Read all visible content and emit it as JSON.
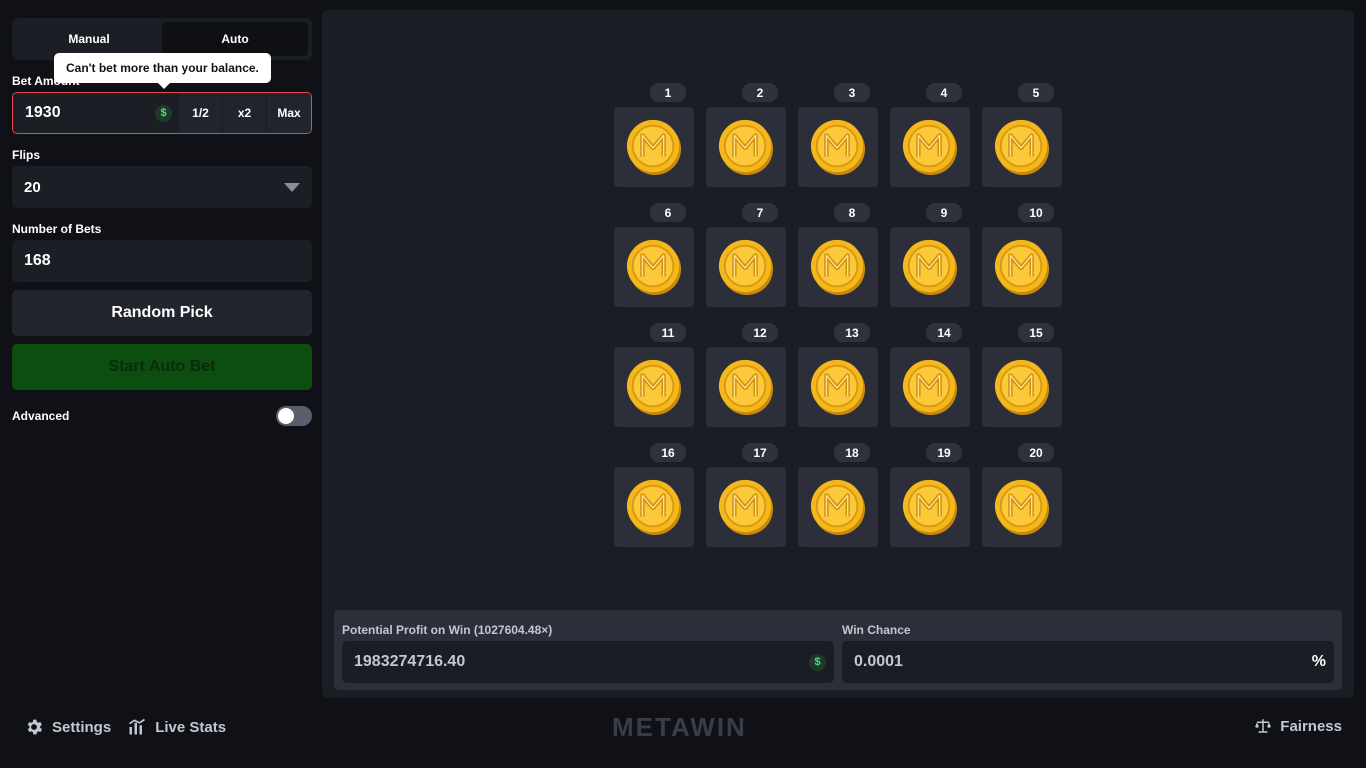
{
  "sidebar": {
    "tabs": [
      {
        "label": "Manual",
        "active": false
      },
      {
        "label": "Auto",
        "active": true
      }
    ],
    "tooltip": "Can't bet more than your balance.",
    "bet": {
      "label": "Bet Amount",
      "value": "1930",
      "currency_symbol": "$",
      "half_label": "1/2",
      "double_label": "x2",
      "max_label": "Max"
    },
    "flips": {
      "label": "Flips",
      "value": "20"
    },
    "num_bets": {
      "label": "Number of Bets",
      "value": "168"
    },
    "random_pick_label": "Random Pick",
    "start_auto_label": "Start Auto Bet",
    "advanced": {
      "label": "Advanced",
      "enabled": false
    }
  },
  "coins": [
    "1",
    "2",
    "3",
    "4",
    "5",
    "6",
    "7",
    "8",
    "9",
    "10",
    "11",
    "12",
    "13",
    "14",
    "15",
    "16",
    "17",
    "18",
    "19",
    "20"
  ],
  "profit": {
    "label": "Potential Profit on Win (1027604.48×)",
    "value": "1983274716.40",
    "currency_symbol": "$"
  },
  "win_chance": {
    "label": "Win Chance",
    "value": "0.0001",
    "suffix": "%"
  },
  "footer": {
    "settings_label": "Settings",
    "live_stats_label": "Live Stats",
    "logo_text": "METAWIN",
    "fairness_label": "Fairness"
  },
  "colors": {
    "error_border": "#e5484d",
    "start_button": "#0b4e10",
    "coin_gold": "#f5b81c",
    "badge_green": "#4ade80"
  },
  "icons": {
    "settings": "gear-icon",
    "live_stats": "bar-chart-icon",
    "fairness": "scale-icon",
    "flips_dropdown": "caret-down-icon",
    "coin": "metawin-coin-icon"
  }
}
